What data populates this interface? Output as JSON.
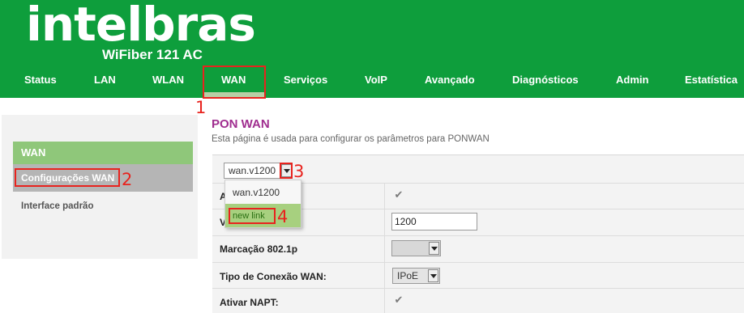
{
  "header": {
    "logo": "intelbras",
    "model": "WiFiber 121 AC",
    "nav": [
      {
        "label": "Status"
      },
      {
        "label": "LAN"
      },
      {
        "label": "WLAN"
      },
      {
        "label": "WAN"
      },
      {
        "label": "Serviços"
      },
      {
        "label": "VoIP"
      },
      {
        "label": "Avançado"
      },
      {
        "label": "Diagnósticos"
      },
      {
        "label": "Admin"
      },
      {
        "label": "Estatística"
      }
    ],
    "active_nav": "WAN"
  },
  "sidebar": {
    "section": "WAN",
    "items": [
      {
        "label": "Configurações WAN",
        "active": true
      },
      {
        "label": "Interface padrão",
        "active": false
      }
    ]
  },
  "main": {
    "title": "PON WAN",
    "description": "Esta página é usada para configurar os parâmetros para PONWAN",
    "connection_select": {
      "value": "wan.v1200",
      "options": [
        "wan.v1200",
        "new link"
      ],
      "highlighted": "new link"
    },
    "rows": {
      "row1_label": "A",
      "row2_label": "V",
      "vlan_value": "1200",
      "marcacao_label": "Marcação 802.1p",
      "marcacao_value": "",
      "tipo_label": "Tipo de Conexão WAN:",
      "tipo_value": "IPoE",
      "napt_label": "Ativar NAPT:"
    }
  },
  "annotations": [
    "1",
    "2",
    "3",
    "4"
  ],
  "colors": {
    "header_green": "#0e9e3c",
    "title_purple": "#a02d8f",
    "annotation_red": "#e8231e",
    "sidebar_green": "#8fc77a"
  }
}
